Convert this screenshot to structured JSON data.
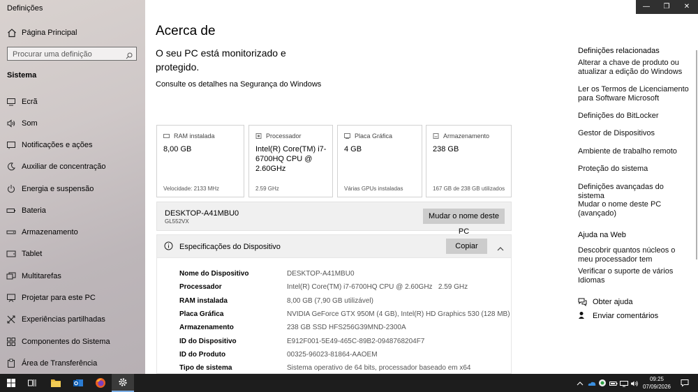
{
  "window": {
    "title": "Definições",
    "controls": {
      "minimize": "—",
      "maximize": "❐",
      "close": "✕"
    }
  },
  "sidebar": {
    "home_label": "Página Principal",
    "search_placeholder": "Procurar uma definição",
    "section_title": "Sistema",
    "items": [
      {
        "label": "Ecrã",
        "icon": "monitor-icon"
      },
      {
        "label": "Som",
        "icon": "speaker-icon"
      },
      {
        "label": "Notificações e ações",
        "icon": "notifications-icon"
      },
      {
        "label": "Auxiliar de concentração",
        "icon": "moon-icon"
      },
      {
        "label": "Energia e suspensão",
        "icon": "power-icon"
      },
      {
        "label": "Bateria",
        "icon": "battery-icon"
      },
      {
        "label": "Armazenamento",
        "icon": "storage-icon"
      },
      {
        "label": "Tablet",
        "icon": "tablet-icon"
      },
      {
        "label": "Multitarefas",
        "icon": "multitasking-icon"
      },
      {
        "label": "Projetar para este PC",
        "icon": "project-icon"
      },
      {
        "label": "Experiências partilhadas",
        "icon": "shared-icon"
      },
      {
        "label": "Componentes do Sistema",
        "icon": "components-icon"
      },
      {
        "label": "Área de Transferência",
        "icon": "clipboard-icon"
      }
    ]
  },
  "main": {
    "title": "Acerca de",
    "protection_text": "O seu PC está monitorizado e protegido.",
    "security_link": "Consulte os detalhes na Segurança do Windows",
    "cards": [
      {
        "header": "RAM instalada",
        "value": "8,00 GB",
        "footer": "Velocidade: 2133 MHz",
        "icon": "ram-icon"
      },
      {
        "header": "Processador",
        "value": "Intel(R) Core(TM) i7-6700HQ CPU @ 2.60GHz",
        "footer": "2.59 GHz",
        "icon": "processor-icon"
      },
      {
        "header": "Placa Gráfica",
        "value": "4 GB",
        "footer": "Várias GPUs instaladas",
        "icon": "graphics-card-icon"
      },
      {
        "header": "Armazenamento",
        "value": "238 GB",
        "footer": "167 GB de 238 GB utilizados",
        "icon": "storage-icon"
      }
    ],
    "pc": {
      "name": "DESKTOP-A41MBU0",
      "model": "GL552VX",
      "rename_label": "Mudar o nome deste PC"
    },
    "specs": {
      "title": "Especificações do Dispositivo",
      "copy_label": "Copiar",
      "rows": [
        {
          "key": "Nome do Dispositivo",
          "value": "DESKTOP-A41MBU0"
        },
        {
          "key": "Processador",
          "value": "Intel(R) Core(TM) i7-6700HQ CPU @ 2.60GHz   2.59 GHz"
        },
        {
          "key": "RAM instalada",
          "value": "8,00 GB (7,90 GB utilizável)"
        },
        {
          "key": "Placa Gráfica",
          "value": "NVIDIA GeForce GTX 950M (4 GB), Intel(R) HD Graphics 530 (128 MB)"
        },
        {
          "key": "Armazenamento",
          "value": "238 GB SSD HFS256G39MND-2300A"
        },
        {
          "key": "ID do Dispositivo",
          "value": "E912F001-5E49-465C-89B2-0948768204F7"
        },
        {
          "key": "ID do Produto",
          "value": "00325-96023-81864-AAOEM"
        },
        {
          "key": "Tipo de sistema",
          "value": "Sistema operativo de 64 bits, processador baseado em x64"
        }
      ]
    }
  },
  "related": {
    "title": "Definições relacionadas",
    "links": [
      "Alterar a chave de produto ou atualizar a edição do Windows",
      "Ler os Termos de Licenciamento para Software Microsoft",
      "Definições do BitLocker",
      "Gestor de Dispositivos",
      "Ambiente de trabalho remoto",
      "Proteção do sistema",
      "Definições avançadas do sistema",
      "Mudar o nome deste PC (avançado)"
    ]
  },
  "web_help": {
    "title": "Ajuda na Web",
    "links": [
      "Descobrir quantos núcleos o meu processador tem",
      "Verificar o suporte de vários Idiomas"
    ]
  },
  "support": {
    "get_help": "Obter ajuda",
    "feedback": "Enviar comentários"
  },
  "taskbar": {
    "time": "09:25",
    "date": "07/09/2026"
  },
  "colors": {
    "taskbar": "#1d1d1d",
    "accent": "#7db0e8",
    "button": "#cccccc"
  }
}
